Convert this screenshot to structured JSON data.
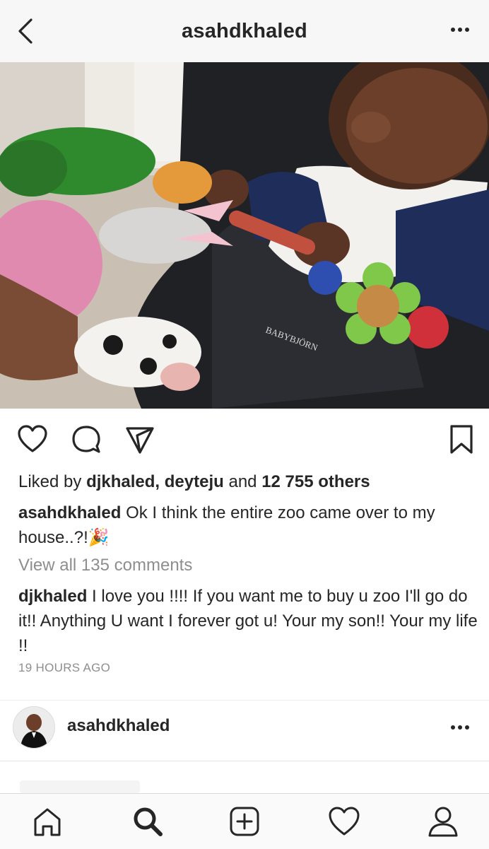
{
  "header": {
    "title": "asahdkhaled",
    "back_icon": "chevron-left-icon",
    "more_icon": "more-horizontal-icon"
  },
  "post": {
    "photo_brand_text": "BABYBJÖRN",
    "actions": [
      "heart-icon",
      "comment-icon",
      "send-icon",
      "bookmark-icon"
    ],
    "likes": {
      "prefix": "Liked by ",
      "user1": "djkhaled",
      "sep": ", ",
      "user2": "deyteju",
      "and": " and ",
      "others": "12 755 others"
    },
    "caption": {
      "username": "asahdkhaled",
      "text": " Ok I think the entire zoo came over to my house..?!🎉"
    },
    "view_all": "View all 135 comments",
    "comment": {
      "username": "djkhaled",
      "text": " I love you !!!! If you want me to  buy  u zoo I'll go do it!! Anything U want I forever got u! Your my son!! Your my life !!"
    },
    "timestamp": "19 HOURS AGO"
  },
  "next_post": {
    "username": "asahdkhaled"
  },
  "tabbar": [
    "home-icon",
    "search-icon",
    "add-post-icon",
    "activity-heart-icon",
    "profile-icon"
  ],
  "colors": {
    "text": "#262626",
    "secondary": "#8e8e8e",
    "border": "#dbdbdb"
  }
}
